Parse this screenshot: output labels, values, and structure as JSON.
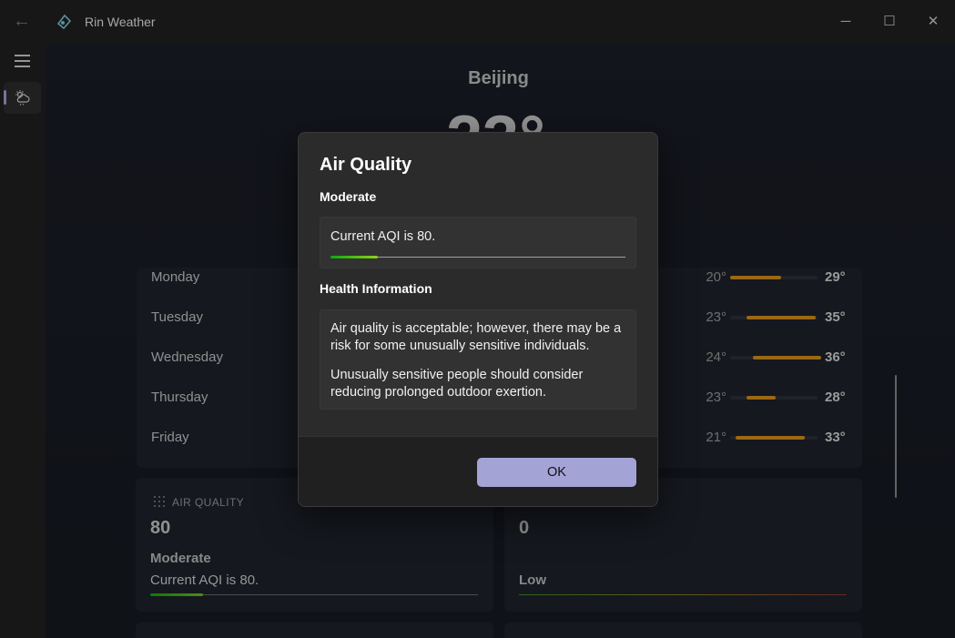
{
  "app": {
    "title": "Rin Weather"
  },
  "titlebar": {
    "back_icon": "back-arrow-icon",
    "minimize": "─",
    "maximize": "☐",
    "close": "✕"
  },
  "current": {
    "city": "Beijing",
    "temperature": "23°"
  },
  "forecast": [
    {
      "day": "Monday",
      "low": "20°",
      "high": "29°"
    },
    {
      "day": "Tuesday",
      "low": "23°",
      "high": "35°"
    },
    {
      "day": "Wednesday",
      "low": "24°",
      "high": "36°"
    },
    {
      "day": "Thursday",
      "low": "23°",
      "high": "28°"
    },
    {
      "day": "Friday",
      "low": "21°",
      "high": "33°"
    }
  ],
  "air_quality_tile": {
    "heading": "AIR QUALITY",
    "value": "80",
    "level": "Moderate",
    "description": "Current AQI is 80."
  },
  "second_tile": {
    "value": "0",
    "level": "Low"
  },
  "dialog": {
    "title": "Air Quality",
    "level": "Moderate",
    "aqi_text": "Current AQI is 80.",
    "health_heading": "Health Information",
    "health_p1": "Air quality is acceptable; however, there may be a risk for some unusually sensitive individuals.",
    "health_p2": "Unusually sensitive people should consider reducing prolonged outdoor exertion.",
    "ok_label": "OK"
  },
  "colors": {
    "accent": "#a3a3d6",
    "temp_bar": "#d7901c",
    "aqi_good": "#12a712"
  }
}
